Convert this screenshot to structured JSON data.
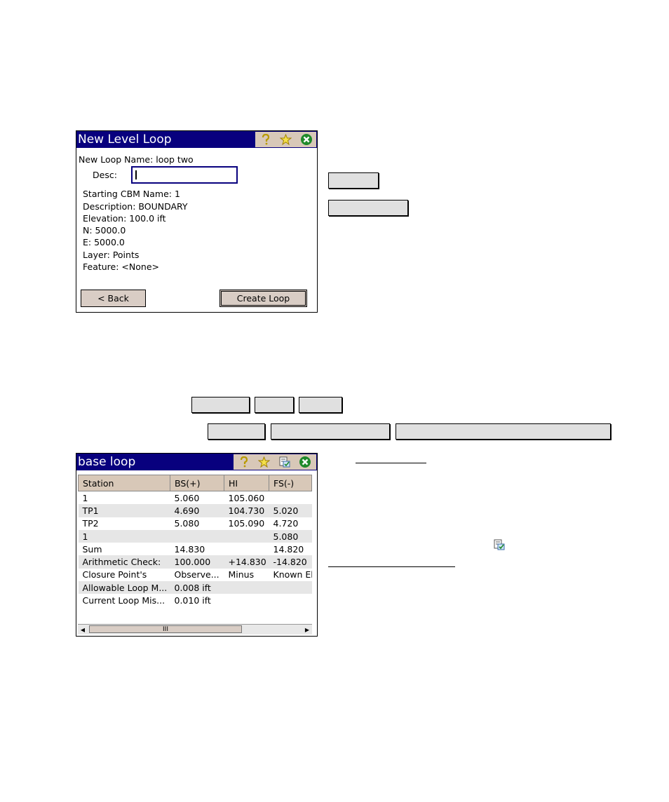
{
  "colors": {
    "titlebar": "#08007e",
    "button_face": "#d9cdc5",
    "header_bg": "#d8c8b8",
    "alt_row": "#e6e6e6"
  },
  "new_loop_window": {
    "title": "New Level Loop",
    "icons": [
      "help-icon",
      "star-icon",
      "close-icon"
    ],
    "loop_name": "New Loop Name: loop two",
    "desc_label": "Desc:",
    "desc_value": "",
    "info": [
      "Starting CBM Name: 1",
      " Description: BOUNDARY",
      " Elevation: 100.0 ift",
      " N: 5000.0",
      " E: 5000.0",
      "Layer: Points",
      "Feature: <None>"
    ],
    "back_button": "< Back",
    "create_button": "Create Loop"
  },
  "base_loop_window": {
    "title": "base loop",
    "icons": [
      "help-icon",
      "star-icon",
      "checklist-icon",
      "close-icon"
    ],
    "columns": [
      "Station",
      "BS(+)",
      "HI",
      "FS(-)"
    ],
    "rows": [
      [
        "1",
        "5.060",
        "105.060",
        ""
      ],
      [
        "TP1",
        "4.690",
        "104.730",
        "5.020"
      ],
      [
        "TP2",
        "5.080",
        "105.090",
        "4.720"
      ],
      [
        "1",
        "",
        "",
        "5.080"
      ],
      [
        "Sum",
        "14.830",
        "",
        "14.820"
      ],
      [
        "Arithmetic Check:",
        "100.000",
        "+14.830",
        "-14.820"
      ],
      [
        "Closure Point's",
        "Observe...",
        "Minus",
        "Known El"
      ],
      [
        "Allowable Loop M...",
        "0.008 ift",
        "",
        ""
      ],
      [
        "Current Loop Mis...",
        "0.010 ift",
        "",
        ""
      ]
    ],
    "scroll_thumb": "III"
  }
}
